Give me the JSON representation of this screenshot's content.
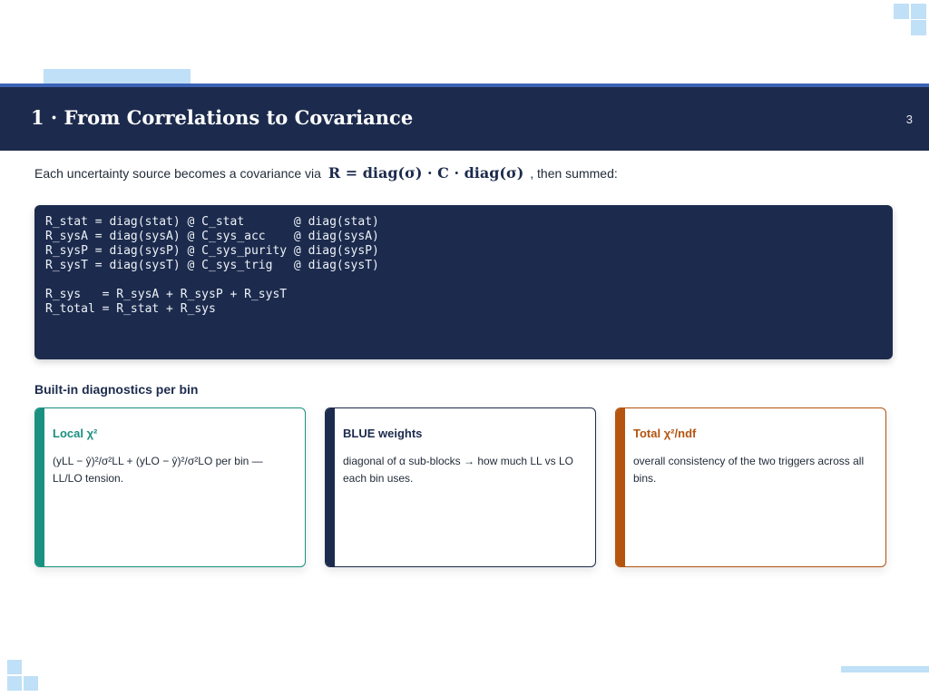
{
  "header": {
    "title": "1 · From Correlations to Covariance",
    "page_number": "3"
  },
  "intro": {
    "text_before": "Each uncertainty source becomes a covariance via",
    "formula": "R = diag(σ) · C · diag(σ)",
    "text_after": ", then summed:"
  },
  "code": {
    "lines": [
      "R_stat = diag(stat) @ C_stat       @ diag(stat)",
      "R_sysA = diag(sysA) @ C_sys_acc    @ diag(sysA)",
      "R_sysP = diag(sysP) @ C_sys_purity @ diag(sysP)",
      "R_sysT = diag(sysT) @ C_sys_trig   @ diag(sysT)",
      "",
      "R_sys   = R_sysA + R_sysP + R_sysT",
      "R_total = R_stat + R_sys"
    ]
  },
  "diagnostics": {
    "title": "Built-in diagnostics per bin",
    "cards": [
      {
        "title": "Local χ²",
        "body": "(yLL − ŷ)²/σ²LL + (yLO − ŷ)²/σ²LO per bin — LL/LO tension."
      },
      {
        "title": "BLUE weights",
        "body": "diagonal of α sub-blocks → how much LL vs LO each bin uses."
      },
      {
        "title": "Total χ²/ndf",
        "body": "overall consistency of the two triggers across all bins."
      }
    ]
  },
  "colors": {
    "navy": "#1c2b4d",
    "teal": "#1a9080",
    "orange": "#b4540e",
    "light_blue": "#bfe0f7",
    "header_line": "#3b63b5"
  }
}
